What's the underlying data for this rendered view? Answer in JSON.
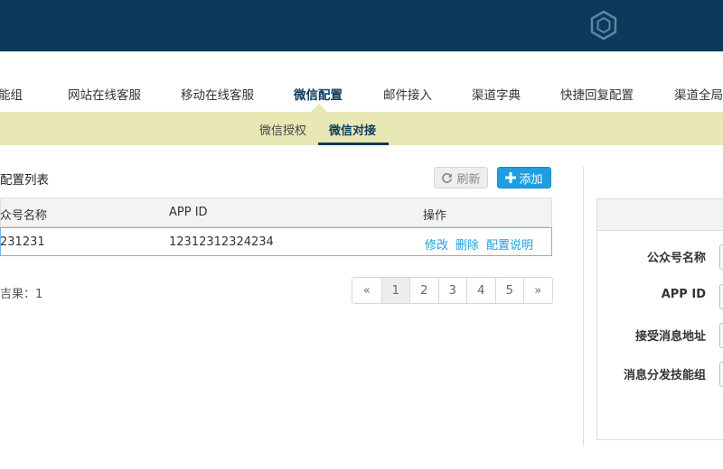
{
  "nav": {
    "items": [
      {
        "label": "能组",
        "active": false
      },
      {
        "label": "网站在线客服",
        "active": false
      },
      {
        "label": "移动在线客服",
        "active": false
      },
      {
        "label": "微信配置",
        "active": true
      },
      {
        "label": "邮件接入",
        "active": false
      },
      {
        "label": "渠道字典",
        "active": false
      },
      {
        "label": "快捷回复配置",
        "active": false
      },
      {
        "label": "渠道全局",
        "active": false
      }
    ]
  },
  "subnav": {
    "items": [
      {
        "label": "微信授权",
        "active": false
      },
      {
        "label": "微信对接",
        "active": true
      }
    ]
  },
  "panel": {
    "title": "配置列表",
    "refresh_label": "刷新",
    "add_label": "添加"
  },
  "table": {
    "columns": [
      "众号名称",
      "APP ID",
      "操作"
    ],
    "rows": [
      {
        "name": "231231",
        "app_id": "12312312324234",
        "actions": [
          "修改",
          "删除",
          "配置说明"
        ]
      }
    ]
  },
  "result_text": "吉果：1",
  "pagination": {
    "items": [
      "«",
      "1",
      "2",
      "3",
      "4",
      "5",
      "»"
    ],
    "active": "1"
  },
  "form": {
    "labels": [
      "公众号名称",
      "APP ID",
      "接受消息地址",
      "消息分发技能组"
    ]
  },
  "colors": {
    "topbar": "#0c3a5a",
    "subnav": "#e8e8b5",
    "accent": "#1e9ee0"
  }
}
